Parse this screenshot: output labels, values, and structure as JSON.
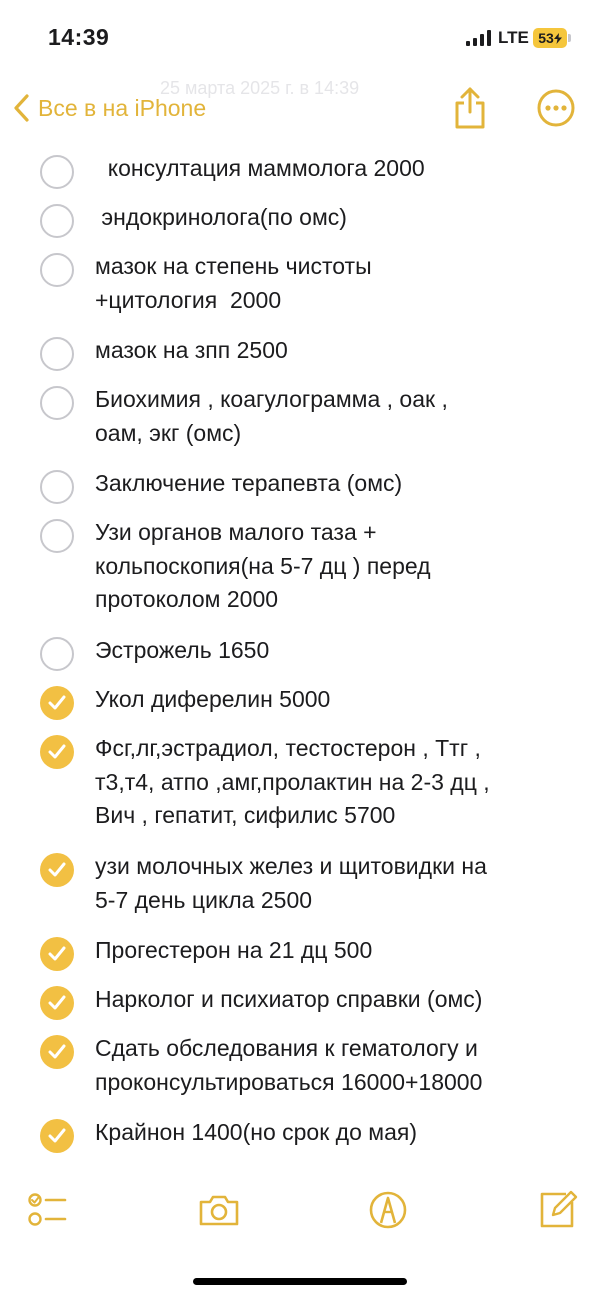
{
  "status_bar": {
    "time": "14:39",
    "network": "LTE",
    "battery": "53"
  },
  "nav": {
    "back_label": "Все в на iPhone",
    "faded_title": "25 марта 2025 г. в 14:39",
    "accent_color": "#e2b43a",
    "icons": [
      "chevron-left-icon",
      "share-icon",
      "more-icon"
    ]
  },
  "checklist": {
    "items": [
      {
        "text": "  консултация маммолога 2000",
        "checked": false
      },
      {
        "text": " эндокринолога(по омс)",
        "checked": false
      },
      {
        "text": "мазок на степень чистоты\n+цитология  2000",
        "checked": false
      },
      {
        "text": "мазок на зпп 2500",
        "checked": false
      },
      {
        "text": "Биохимия , коагулограмма , оак ,\nоам, экг (омс)",
        "checked": false
      },
      {
        "text": "Заключение терапевта (омс)",
        "checked": false
      },
      {
        "text": "Узи органов малого таза +\nкольпоскопия(на 5-7 дц ) перед\nпротоколом 2000",
        "checked": false
      },
      {
        "text": "Эстрожель 1650",
        "checked": false
      },
      {
        "text": "Укол диферелин 5000",
        "checked": true
      },
      {
        "text": "Фсг,лг,эстрадиол, тестостерон , Ттг ,\nт3,т4, атпо ,амг,пролактин на 2-3 дц ,\nВич , гепатит, сифилис 5700",
        "checked": true
      },
      {
        "text": "узи молочных желез и щитовидки на\n5-7 день цикла 2500",
        "checked": true
      },
      {
        "text": "Прогестерон на 21 дц 500",
        "checked": true
      },
      {
        "text": "Нарколог и психиатор справки (омс)",
        "checked": true
      },
      {
        "text": "Сдать обследования к гематологу и\nпроконсультироваться 16000+18000",
        "checked": true
      },
      {
        "text": "Крайнон 1400(но срок до мая)",
        "checked": true
      }
    ],
    "check_color": "#f2c043"
  },
  "toolbar": {
    "icons": [
      "checklist-icon",
      "camera-icon",
      "markup-pen-icon",
      "compose-icon"
    ]
  }
}
